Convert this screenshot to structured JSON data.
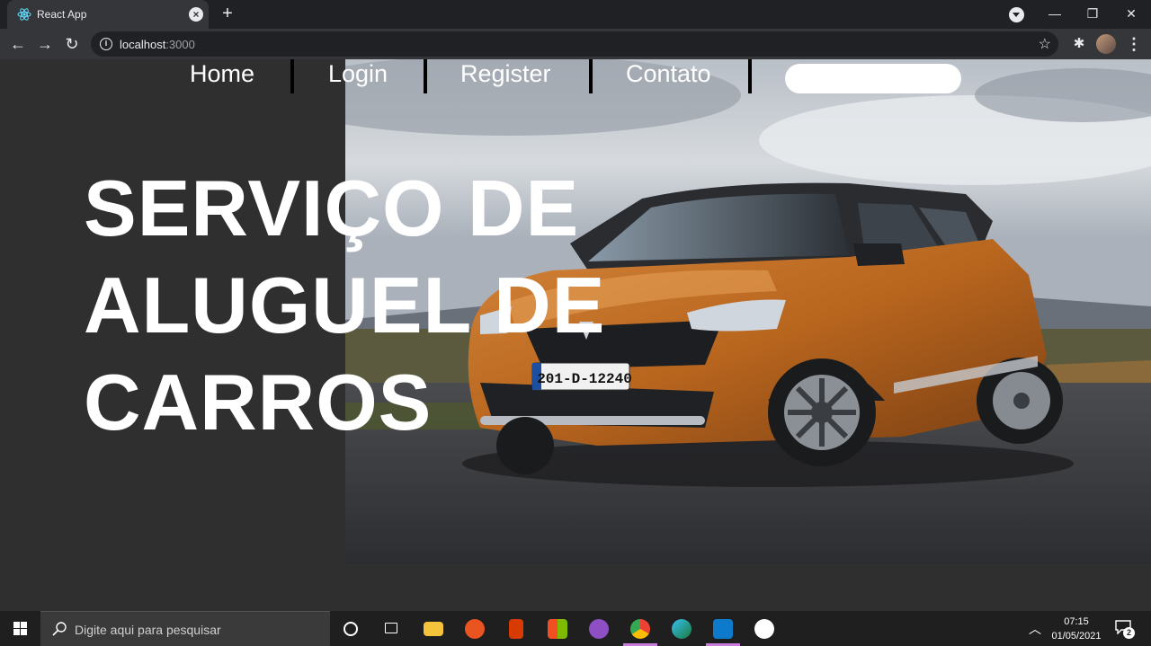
{
  "browser": {
    "tab_title": "React App",
    "url_host": "localhost",
    "url_port": ":3000"
  },
  "nav": {
    "links": [
      "Home",
      "Login",
      "Register",
      "Contato"
    ],
    "search_placeholder": ""
  },
  "hero": {
    "title_lines": [
      "SERVIÇO DE",
      "ALUGUEL DE",
      "CARROS"
    ],
    "plate_text": "201-D-12240"
  },
  "taskbar": {
    "search_placeholder": "Digite aqui para pesquisar",
    "time": "07:15",
    "date": "01/05/2021",
    "notification_count": "2"
  },
  "colors": {
    "page_background": "#2f2f2f",
    "car_body": "#b8651e",
    "browser_frame": "#202124"
  }
}
